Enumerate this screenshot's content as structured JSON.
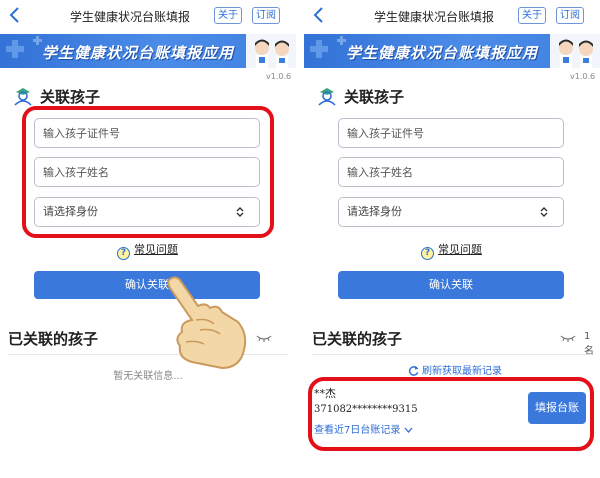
{
  "left": {
    "topbar": {
      "title": "学生健康状况台账填报",
      "about_label": "关于",
      "subscribe_label": "订阅"
    },
    "banner": {
      "title": "学生健康状况台账填报应用",
      "version": "v1.0.6"
    },
    "section": {
      "title": "关联孩子"
    },
    "form": {
      "id_placeholder": "输入孩子证件号",
      "name_placeholder": "输入孩子姓名",
      "identity_select": "请选择身份"
    },
    "faq_label": "常见问题",
    "confirm_label": "确认关联",
    "linked": {
      "title": "已关联的孩子",
      "empty_text": "暂无关联信息..."
    }
  },
  "right": {
    "topbar": {
      "title": "学生健康状况台账填报",
      "about_label": "关于",
      "subscribe_label": "订阅"
    },
    "banner": {
      "title": "学生健康状况台账填报应用",
      "version": "v1.0.6"
    },
    "section": {
      "title": "关联孩子"
    },
    "form": {
      "id_placeholder": "输入孩子证件号",
      "name_placeholder": "输入孩子姓名",
      "identity_select": "请选择身份"
    },
    "faq_label": "常见问题",
    "confirm_label": "确认关联",
    "linked": {
      "title": "已关联的孩子",
      "count": "1名",
      "refresh_label": "刷新获取最新记录",
      "child": {
        "name": "**杰",
        "id_number": "371082********9315",
        "records_link": "查看近7日台账记录",
        "fill_button": "填报台账"
      }
    }
  },
  "colors": {
    "accent": "#3a78dc",
    "banner": "#4c8ce8",
    "highlight": "#e3101a"
  }
}
